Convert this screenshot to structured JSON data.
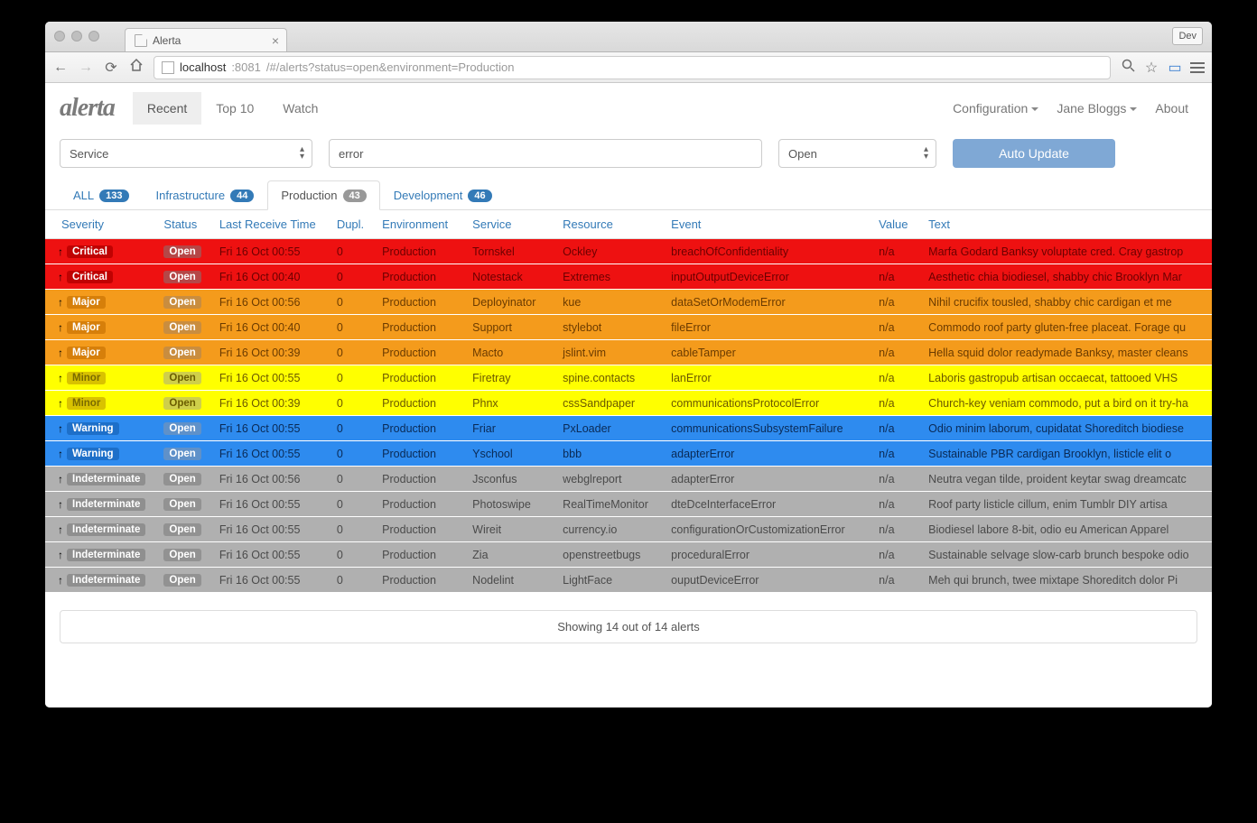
{
  "browser": {
    "tab_title": "Alerta",
    "dev_button": "Dev",
    "url_host": "localhost",
    "url_port": ":8081",
    "url_path": "/#/alerts?status=open&environment=Production"
  },
  "nav": {
    "brand": "alerta",
    "tabs": [
      {
        "label": "Recent",
        "active": true
      },
      {
        "label": "Top 10",
        "active": false
      },
      {
        "label": "Watch",
        "active": false
      }
    ],
    "right": {
      "config": "Configuration",
      "user": "Jane Bloggs",
      "about": "About"
    }
  },
  "filters": {
    "service_label": "Service",
    "search_value": "error",
    "status_label": "Open",
    "auto_update": "Auto Update"
  },
  "env_tabs": [
    {
      "label": "ALL",
      "count": "133",
      "active": false
    },
    {
      "label": "Infrastructure",
      "count": "44",
      "active": false
    },
    {
      "label": "Production",
      "count": "43",
      "active": true
    },
    {
      "label": "Development",
      "count": "46",
      "active": false
    }
  ],
  "columns": [
    "Severity",
    "Status",
    "Last Receive Time",
    "Dupl.",
    "Environment",
    "Service",
    "Resource",
    "Event",
    "Value",
    "Text"
  ],
  "rows": [
    {
      "sev": "Critical",
      "sevclass": "critical",
      "status": "Open",
      "time": "Fri 16 Oct 00:55",
      "dupl": "0",
      "env": "Production",
      "svc": "Tornskel",
      "res": "Ockley",
      "event": "breachOfConfidentiality",
      "val": "n/a",
      "text": "Marfa Godard Banksy voluptate cred. Cray gastrop"
    },
    {
      "sev": "Critical",
      "sevclass": "critical",
      "status": "Open",
      "time": "Fri 16 Oct 00:40",
      "dupl": "0",
      "env": "Production",
      "svc": "Notestack",
      "res": "Extremes",
      "event": "inputOutputDeviceError",
      "val": "n/a",
      "text": "Aesthetic chia biodiesel, shabby chic Brooklyn Mar"
    },
    {
      "sev": "Major",
      "sevclass": "major",
      "status": "Open",
      "time": "Fri 16 Oct 00:56",
      "dupl": "0",
      "env": "Production",
      "svc": "Deployinator",
      "res": "kue",
      "event": "dataSetOrModemError",
      "val": "n/a",
      "text": "Nihil crucifix tousled, shabby chic cardigan et me"
    },
    {
      "sev": "Major",
      "sevclass": "major",
      "status": "Open",
      "time": "Fri 16 Oct 00:40",
      "dupl": "0",
      "env": "Production",
      "svc": "Support",
      "res": "stylebot",
      "event": "fileError",
      "val": "n/a",
      "text": "Commodo roof party gluten-free placeat. Forage qu"
    },
    {
      "sev": "Major",
      "sevclass": "major",
      "status": "Open",
      "time": "Fri 16 Oct 00:39",
      "dupl": "0",
      "env": "Production",
      "svc": "Macto",
      "res": "jslint.vim",
      "event": "cableTamper",
      "val": "n/a",
      "text": "Hella squid dolor readymade Banksy, master cleans"
    },
    {
      "sev": "Minor",
      "sevclass": "minor",
      "status": "Open",
      "time": "Fri 16 Oct 00:55",
      "dupl": "0",
      "env": "Production",
      "svc": "Firetray",
      "res": "spine.contacts",
      "event": "lanError",
      "val": "n/a",
      "text": "Laboris gastropub artisan occaecat, tattooed VHS"
    },
    {
      "sev": "Minor",
      "sevclass": "minor",
      "status": "Open",
      "time": "Fri 16 Oct 00:39",
      "dupl": "0",
      "env": "Production",
      "svc": "Phnx",
      "res": "cssSandpaper",
      "event": "communicationsProtocolError",
      "val": "n/a",
      "text": "Church-key veniam commodo, put a bird on it try-ha"
    },
    {
      "sev": "Warning",
      "sevclass": "warning",
      "status": "Open",
      "time": "Fri 16 Oct 00:55",
      "dupl": "0",
      "env": "Production",
      "svc": "Friar",
      "res": "PxLoader",
      "event": "communicationsSubsystemFailure",
      "val": "n/a",
      "text": "Odio minim laborum, cupidatat Shoreditch biodiese"
    },
    {
      "sev": "Warning",
      "sevclass": "warning",
      "status": "Open",
      "time": "Fri 16 Oct 00:55",
      "dupl": "0",
      "env": "Production",
      "svc": "Yschool",
      "res": "bbb",
      "event": "adapterError",
      "val": "n/a",
      "text": "Sustainable PBR cardigan Brooklyn, listicle elit o"
    },
    {
      "sev": "Indeterminate",
      "sevclass": "indeterminate",
      "status": "Open",
      "time": "Fri 16 Oct 00:56",
      "dupl": "0",
      "env": "Production",
      "svc": "Jsconfus",
      "res": "webglreport",
      "event": "adapterError",
      "val": "n/a",
      "text": "Neutra vegan tilde, proident keytar swag dreamcatc"
    },
    {
      "sev": "Indeterminate",
      "sevclass": "indeterminate",
      "status": "Open",
      "time": "Fri 16 Oct 00:55",
      "dupl": "0",
      "env": "Production",
      "svc": "Photoswipe",
      "res": "RealTimeMonitor",
      "event": "dteDceInterfaceError",
      "val": "n/a",
      "text": "Roof party listicle cillum, enim Tumblr DIY artisa"
    },
    {
      "sev": "Indeterminate",
      "sevclass": "indeterminate",
      "status": "Open",
      "time": "Fri 16 Oct 00:55",
      "dupl": "0",
      "env": "Production",
      "svc": "Wireit",
      "res": "currency.io",
      "event": "configurationOrCustomizationError",
      "val": "n/a",
      "text": "Biodiesel labore 8-bit, odio eu American Apparel"
    },
    {
      "sev": "Indeterminate",
      "sevclass": "indeterminate",
      "status": "Open",
      "time": "Fri 16 Oct 00:55",
      "dupl": "0",
      "env": "Production",
      "svc": "Zia",
      "res": "openstreetbugs",
      "event": "proceduralError",
      "val": "n/a",
      "text": "Sustainable selvage slow-carb brunch bespoke odio"
    },
    {
      "sev": "Indeterminate",
      "sevclass": "indeterminate",
      "status": "Open",
      "time": "Fri 16 Oct 00:55",
      "dupl": "0",
      "env": "Production",
      "svc": "Nodelint",
      "res": "LightFace",
      "event": "ouputDeviceError",
      "val": "n/a",
      "text": "Meh qui brunch, twee mixtape Shoreditch dolor Pi"
    }
  ],
  "footer": "Showing 14 out of 14 alerts"
}
